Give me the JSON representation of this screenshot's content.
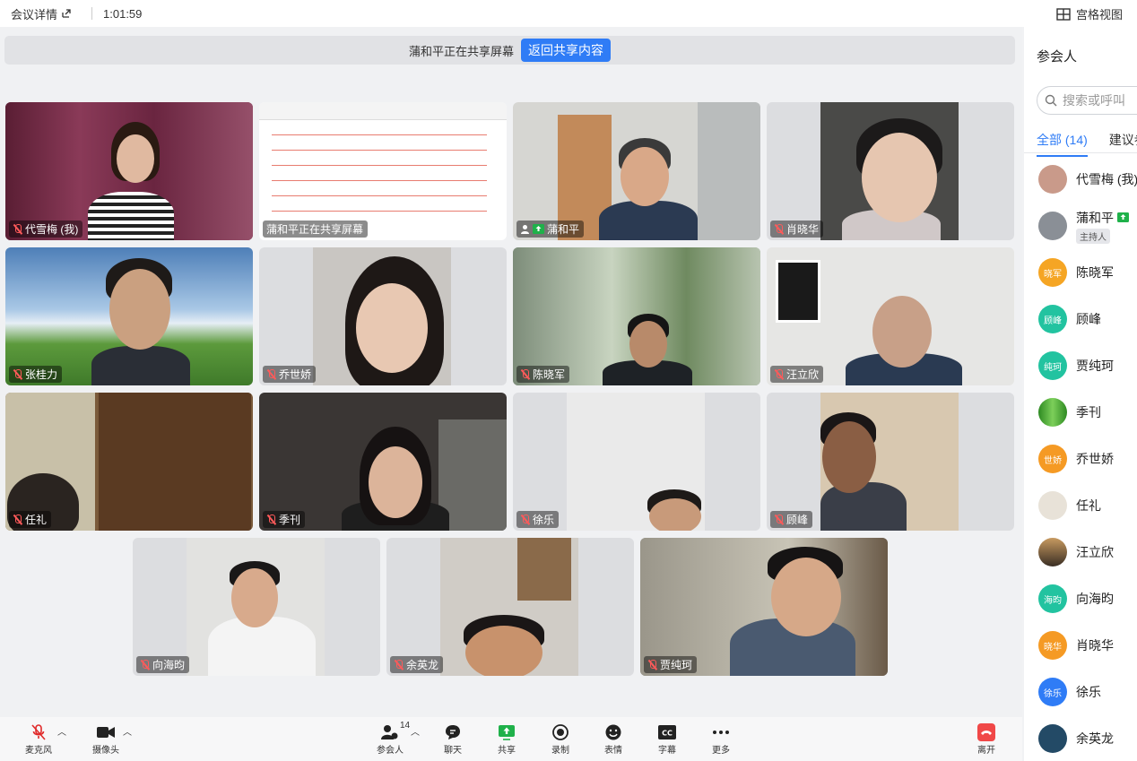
{
  "topbar": {
    "meeting_details": "会议详情",
    "timer": "1:01:59",
    "grid_view": "宫格视图"
  },
  "share_banner": {
    "text": "蒲和平正在共享屏幕",
    "return_button": "返回共享内容"
  },
  "tiles": [
    {
      "name": "代雪梅 (我)"
    },
    {
      "name": "蒲和平正在共享屏幕"
    },
    {
      "name": "蒲和平"
    },
    {
      "name": "肖晓华"
    },
    {
      "name": "张桂力"
    },
    {
      "name": "乔世娇"
    },
    {
      "name": "陈晓军"
    },
    {
      "name": "汪立欣"
    },
    {
      "name": "任礼"
    },
    {
      "name": "季刊"
    },
    {
      "name": "徐乐"
    },
    {
      "name": "顾峰"
    },
    {
      "name": "向海昀"
    },
    {
      "name": "余英龙"
    },
    {
      "name": "贾纯珂"
    }
  ],
  "sidebar": {
    "title": "参会人",
    "search_placeholder": "搜索或呼叫",
    "tab_all": "全部 (14)",
    "tab_suggest": "建议参",
    "host_badge": "主持人",
    "participants": [
      {
        "name": "代雪梅 (我)",
        "avatar_text": "",
        "color": "#c99a8a"
      },
      {
        "name": "蒲和平",
        "avatar_text": "",
        "color": "#8a8f96"
      },
      {
        "name": "陈晓军",
        "avatar_text": "晓军",
        "color": "#f5a524"
      },
      {
        "name": "顾峰",
        "avatar_text": "顾峰",
        "color": "#22c3a0"
      },
      {
        "name": "贾纯珂",
        "avatar_text": "纯珂",
        "color": "#22c3a0"
      },
      {
        "name": "季刊",
        "avatar_text": "",
        "color": "#4caf3a"
      },
      {
        "name": "乔世娇",
        "avatar_text": "世娇",
        "color": "#f59a24"
      },
      {
        "name": "任礼",
        "avatar_text": "",
        "color": "#e8e2d8"
      },
      {
        "name": "汪立欣",
        "avatar_text": "",
        "color": "#7a6a58"
      },
      {
        "name": "向海昀",
        "avatar_text": "海昀",
        "color": "#22c3a0"
      },
      {
        "name": "肖晓华",
        "avatar_text": "晓华",
        "color": "#f59a24"
      },
      {
        "name": "徐乐",
        "avatar_text": "徐乐",
        "color": "#2f7cf6"
      },
      {
        "name": "余英龙",
        "avatar_text": "",
        "color": "#234a66"
      }
    ]
  },
  "toolbar": {
    "mic": "麦克风",
    "camera": "摄像头",
    "participants": "参会人",
    "participant_count": "14",
    "chat": "聊天",
    "share": "共享",
    "record": "录制",
    "reactions": "表情",
    "captions": "字幕",
    "more": "更多",
    "leave": "离开"
  },
  "colors": {
    "accent": "#2f7cf6",
    "share_green": "#1fb14a",
    "leave_red": "#f04848",
    "mic_off_red": "#ff5a5a"
  }
}
